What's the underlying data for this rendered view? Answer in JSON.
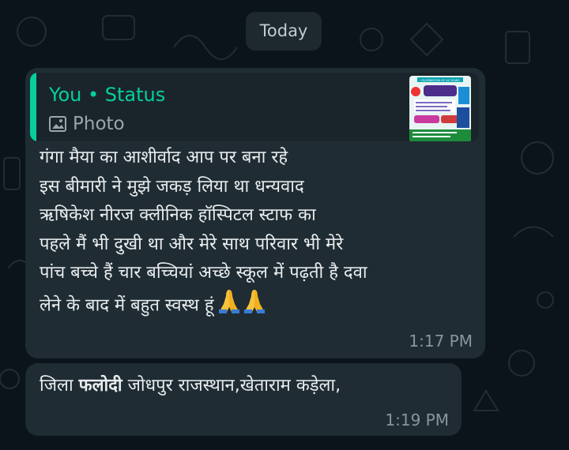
{
  "date_separator": "Today",
  "messages": [
    {
      "quote_title": "You • Status",
      "quote_subtitle": "Photo",
      "quote_icon": "image-icon",
      "thumbnail_caption": "CELEBRATION OF 40 YEARS",
      "text": "गंगा मैया का आशीर्वाद आप पर बना रहे\nइस बीमारी ने मुझे  जकड़ लिया था धन्यवाद\nऋषिकेश नीरज क्लीनिक हॉस्पिटल स्टाफ का\nपहले मैं भी दुखी था और मेरे साथ परिवार भी मेरे\nपांच बच्चे हैं चार बच्चियां अच्छे स्कूल में पढ़ती है दवा\nलेने के बाद में बहुत स्वस्थ हूं",
      "emoji": "folded-hands-icon",
      "time": "1:17 PM"
    },
    {
      "text_before": "जिला ",
      "text_bold": "फलोदी",
      "text_after": " जोधपुर राजस्थान,खेताराम कड़ेला,",
      "time": "1:19 PM"
    }
  ],
  "colors": {
    "background": "#0b141a",
    "bubble": "#1f2c33",
    "accent": "#06cf9c",
    "text": "#e9edef",
    "muted": "#8696a0"
  }
}
